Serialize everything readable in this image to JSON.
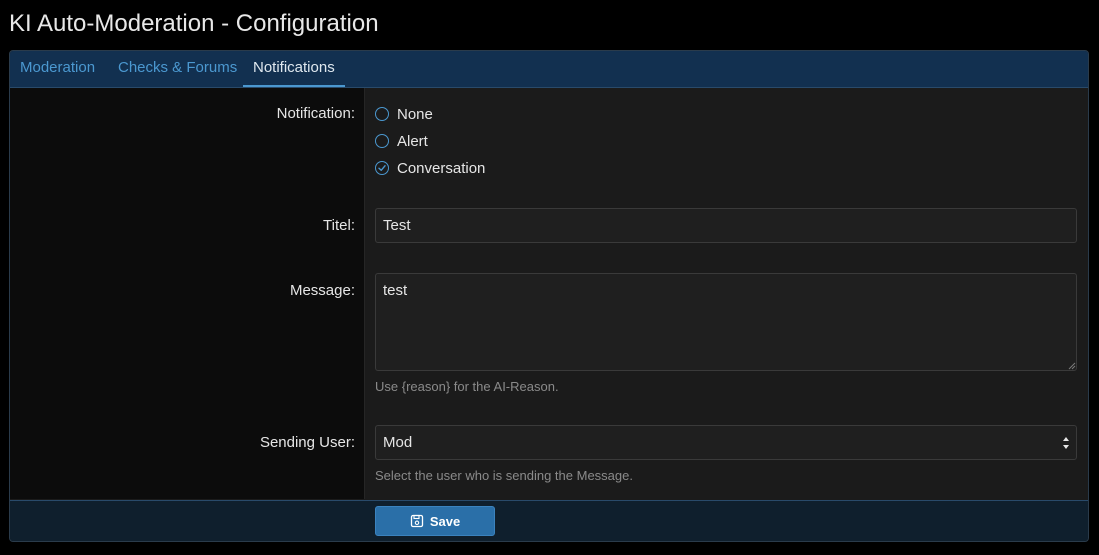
{
  "page": {
    "title": "KI Auto-Moderation - Configuration"
  },
  "tabs": [
    {
      "label": "Moderation",
      "active": false
    },
    {
      "label": "Checks & Forums",
      "active": false
    },
    {
      "label": "Notifications",
      "active": true
    }
  ],
  "notification": {
    "label": "Notification:",
    "options": [
      {
        "label": "None",
        "checked": false
      },
      {
        "label": "Alert",
        "checked": false
      },
      {
        "label": "Conversation",
        "checked": true
      }
    ]
  },
  "title_field": {
    "label": "Titel:",
    "value": "Test"
  },
  "message_field": {
    "label": "Message:",
    "value": "test",
    "hint": "Use {reason} for the AI-Reason."
  },
  "sending_user": {
    "label": "Sending User:",
    "selected": "Mod",
    "hint": "Select the user who is sending the Message."
  },
  "footer": {
    "save_label": "Save"
  },
  "colors": {
    "accent": "#4b98d0",
    "tab_bar": "#123050",
    "button": "#2a6fa8",
    "background": "#1b1b1b"
  }
}
